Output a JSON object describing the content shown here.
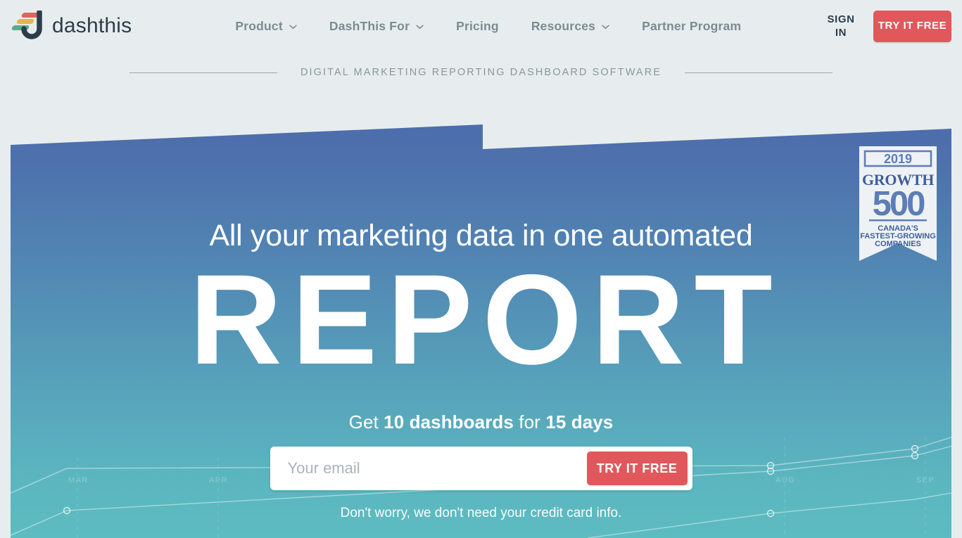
{
  "brand": {
    "name": "dashthis",
    "logo_icon": "dashthis-logo-icon",
    "logo_colors": [
      "#e0645e",
      "#e8b44a",
      "#5aab8c",
      "#2d3d49"
    ]
  },
  "header": {
    "nav": [
      {
        "label": "Product",
        "has_dropdown": true,
        "icon": "chevron-down-icon"
      },
      {
        "label": "DashThis For",
        "has_dropdown": true,
        "icon": "chevron-down-icon"
      },
      {
        "label": "Pricing",
        "has_dropdown": false
      },
      {
        "label": "Resources",
        "has_dropdown": true,
        "icon": "chevron-down-icon"
      },
      {
        "label": "Partner Program",
        "has_dropdown": false
      }
    ],
    "sign_in": "SIGN IN",
    "cta": "TRY IT FREE",
    "cta_color": "#e0585b",
    "background": "#e7edee"
  },
  "tagline": {
    "text": "DIGITAL MARKETING REPORTING DASHBOARD SOFTWARE"
  },
  "hero": {
    "headline": "All your marketing data in one automated",
    "big_word": "REPORT",
    "subline": {
      "part1": "Get ",
      "bold1": "10 dashboards",
      "part2": " for ",
      "bold2": "15 days"
    },
    "email_placeholder": "Your email",
    "email_value": "",
    "cta": "TRY IT FREE",
    "reassurance": "Don't worry, we don't need your credit card info.",
    "gradient_top": "#4d6cab",
    "gradient_bottom": "#5cbcc1"
  },
  "badge": {
    "year": "2019",
    "word": "GROWTH",
    "number": "500",
    "line1": "CANADA'S",
    "line2": "FASTEST-GROWING",
    "line3": "COMPANIES",
    "color": "#5d7db5"
  },
  "chart_data": {
    "type": "line",
    "title": "",
    "xlabel": "",
    "ylabel": "",
    "categories": [
      "MAR",
      "APR",
      "AUG",
      "SEP"
    ],
    "tick_positions": [
      95,
      295,
      1100,
      1300
    ],
    "grid": true,
    "legend": "none",
    "series": [
      {
        "name": "series-1",
        "values": [
          null,
          null,
          96,
          80
        ]
      },
      {
        "name": "series-2",
        "values": [
          null,
          null,
          118,
          102
        ]
      },
      {
        "name": "series-3",
        "values": [
          null,
          null,
          155,
          138
        ]
      }
    ]
  }
}
